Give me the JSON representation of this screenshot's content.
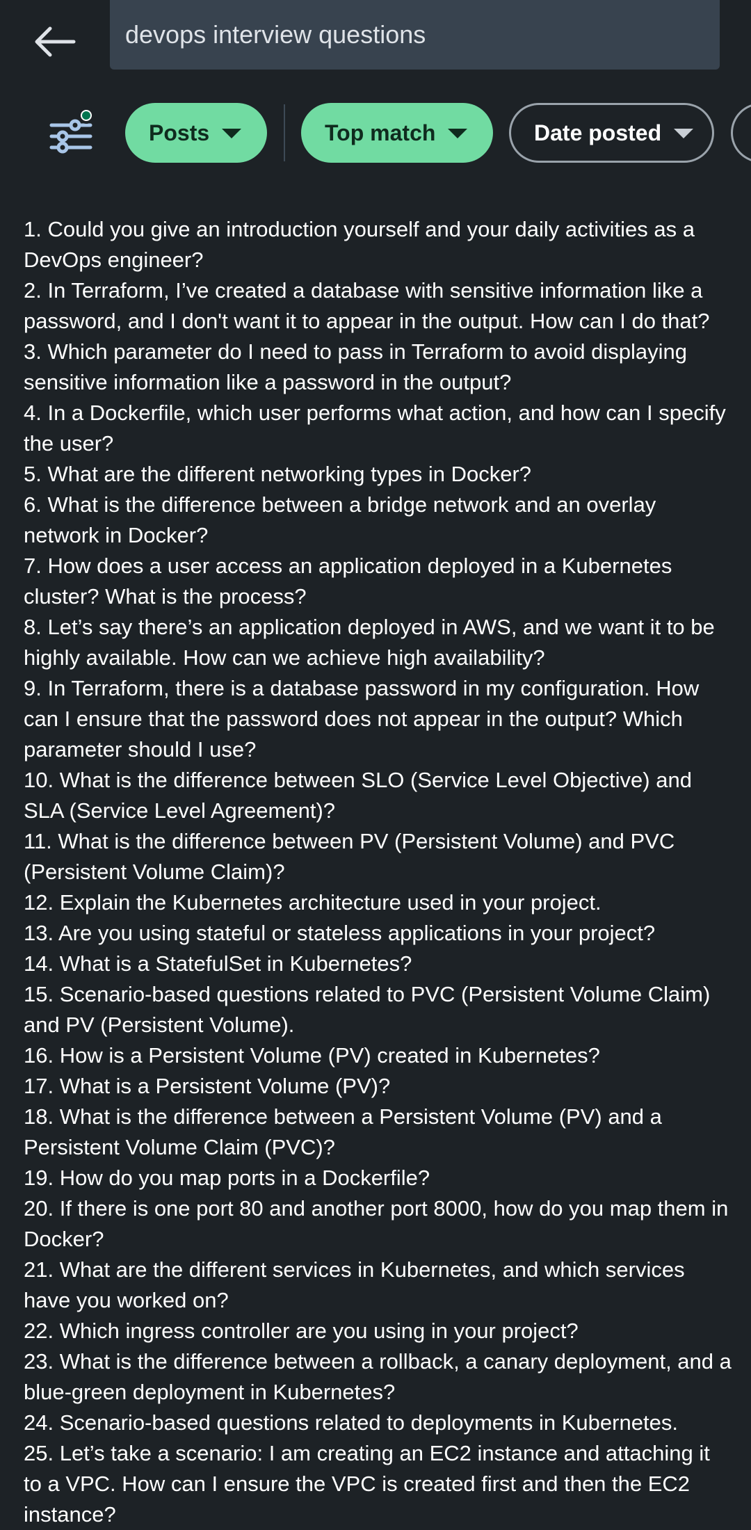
{
  "search": {
    "query": "devops interview questions"
  },
  "filters": {
    "posts_label": "Posts",
    "sort_label": "Top match",
    "date_label": "Date posted"
  },
  "post": {
    "questions": [
      "1. Could you give an introduction yourself and your daily activities as a DevOps engineer?",
      "2. In Terraform, I’ve created a database with sensitive information like a password, and I don't want it to appear in the output. How can I do that?",
      "3. Which parameter do I need to pass in Terraform to avoid displaying sensitive information like a password in the output?",
      "4. In a Dockerfile, which user performs what action, and how can I specify the user?",
      "5. What are the different networking types in Docker?",
      "6. What is the difference between a bridge network and an overlay network in Docker?",
      "7. How does a user access an application deployed in a Kubernetes cluster? What is the process?",
      "8. Let’s say there’s an application deployed in AWS, and we want it to be highly available. How can we achieve high availability?",
      "9. In Terraform, there is a database password in my configuration. How can I ensure that the password does not appear in the output? Which parameter should I use?",
      "10. What is the difference between SLO (Service Level Objective) and SLA (Service Level Agreement)?",
      "11. What is the difference between PV (Persistent Volume) and PVC (Persistent Volume Claim)?",
      "12. Explain the Kubernetes architecture used in your project.",
      "13. Are you using stateful or stateless applications in your project?",
      "14. What is a StatefulSet in Kubernetes?",
      "15. Scenario-based questions related to PVC (Persistent Volume Claim) and PV (Persistent Volume).",
      "16. How is a Persistent Volume (PV) created in Kubernetes?",
      "17. What is a Persistent Volume (PV)?",
      "18. What is the difference between a Persistent Volume (PV) and a Persistent Volume Claim (PVC)?",
      "19. How do you map ports in a Dockerfile?",
      "20. If there is one port 80 and another port 8000, how do you map them in Docker?",
      "21. What are the different services in Kubernetes, and which services have you worked on?",
      "22. Which ingress controller are you using in your project?",
      "23. What is the difference between a rollback, a canary deployment, and a blue-green deployment in Kubernetes?",
      "24. Scenario-based questions related to deployments in Kubernetes.",
      "25. Let’s take a scenario: I am creating an EC2 instance and attaching it to a VPC. How can I ensure the VPC is created first and then the EC2 instance?"
    ]
  }
}
